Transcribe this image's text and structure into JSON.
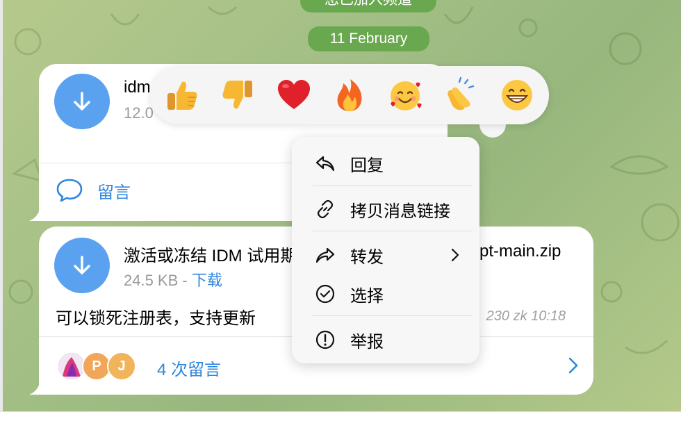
{
  "chat": {
    "service_top": "您已加入频道",
    "date_label": "11 February"
  },
  "message1": {
    "file_name": "idm",
    "file_meta": "12.0",
    "comment_label": "留言"
  },
  "message2": {
    "file_name": "激活或冻结 IDM 试用期",
    "file_name_tail": "pt-main.zip",
    "file_size": "24.5 KB",
    "separator": " - ",
    "download_label": "下载",
    "caption": "可以锁死注册表，支持更新",
    "meta": "230 zk 10:18",
    "comments_count_label": "4 次留言",
    "avatars": [
      {
        "initial": "",
        "color": "#e04070"
      },
      {
        "initial": "P",
        "color": "#f2a65a"
      },
      {
        "initial": "J",
        "color": "#f2b45a"
      }
    ]
  },
  "reactions": [
    {
      "name": "thumbs-up",
      "glyph": "👍"
    },
    {
      "name": "thumbs-down",
      "glyph": "👎"
    },
    {
      "name": "heart",
      "glyph": "❤️"
    },
    {
      "name": "fire",
      "glyph": "🔥"
    },
    {
      "name": "smiling-face-with-hearts",
      "glyph": "🥰"
    },
    {
      "name": "clapping-hands",
      "glyph": "👏"
    },
    {
      "name": "grinning-face",
      "glyph": "😁"
    }
  ],
  "context_menu": {
    "reply": "回复",
    "copy_link": "拷贝消息链接",
    "forward": "转发",
    "select": "选择",
    "report": "举报"
  },
  "colors": {
    "accent": "#2e86de",
    "download_button": "#5aa2f0",
    "service_pill": "#6aa84f"
  }
}
